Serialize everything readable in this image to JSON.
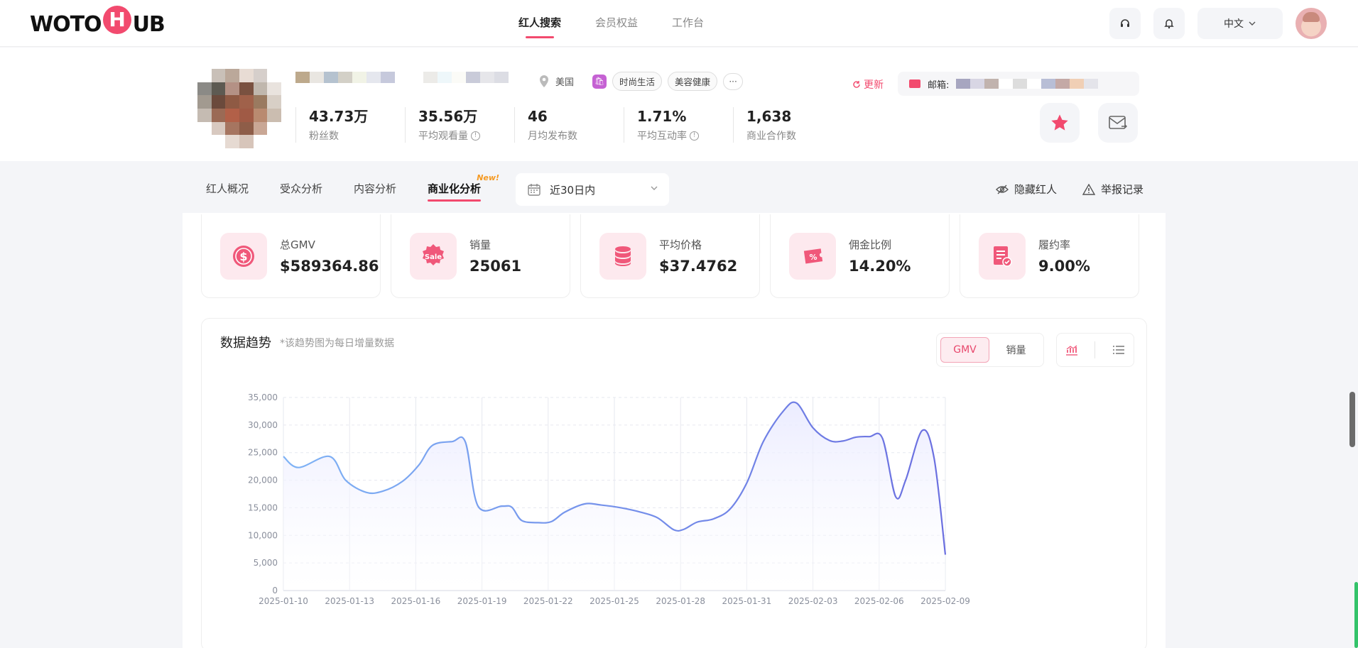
{
  "brand": {
    "logo_text_left": "WOTO",
    "logo_mark": "H",
    "logo_text_right": "UB",
    "accent": "#f24a6e"
  },
  "topnav": {
    "items": [
      {
        "label": "红人搜索",
        "active": true
      },
      {
        "label": "会员权益",
        "active": false
      },
      {
        "label": "工作台",
        "active": false
      }
    ],
    "language": "中文",
    "icons": [
      "headset-icon",
      "bell-icon",
      "chevron-down-icon",
      "user-avatar"
    ]
  },
  "profile": {
    "location": "美国",
    "tags": [
      "时尚生活",
      "美容健康"
    ],
    "more_label": "···",
    "stats": [
      {
        "value": "43.73万",
        "label": "粉丝数",
        "info": false
      },
      {
        "value": "35.56万",
        "label": "平均观看量",
        "info": true
      },
      {
        "value": "46",
        "label": "月均发布数",
        "info": false
      },
      {
        "value": "1.71%",
        "label": "平均互动率",
        "info": true
      },
      {
        "value": "1,638",
        "label": "商业合作数",
        "info": false
      }
    ],
    "update_label": "更新",
    "email_label": "邮箱:"
  },
  "tabs": {
    "items": [
      {
        "label": "红人概况",
        "active": false
      },
      {
        "label": "受众分析",
        "active": false
      },
      {
        "label": "内容分析",
        "active": false
      },
      {
        "label": "商业化分析",
        "active": true,
        "badge": "New!"
      }
    ],
    "date_range": "近30日内",
    "hide_label": "隐藏红人",
    "report_label": "举报记录"
  },
  "metrics": [
    {
      "label": "总GMV",
      "value": "$589364.86",
      "icon": "dollar-coin-icon"
    },
    {
      "label": "销量",
      "value": "25061",
      "icon": "sale-badge-icon"
    },
    {
      "label": "平均价格",
      "value": "$37.4762",
      "icon": "coin-stack-icon"
    },
    {
      "label": "佣金比例",
      "value": "14.20%",
      "icon": "ticket-percent-icon"
    },
    {
      "label": "履约率",
      "value": "9.00%",
      "icon": "document-check-icon"
    }
  ],
  "trend": {
    "title": "数据趋势",
    "note": "*该趋势图为每日增量数据",
    "toggle": [
      {
        "label": "GMV",
        "active": true
      },
      {
        "label": "销量",
        "active": false
      }
    ]
  },
  "chart_data": {
    "type": "area",
    "series": [
      {
        "values": [
          24300,
          22300,
          24300,
          20000,
          17800,
          18000,
          19800,
          22800,
          26300,
          27000,
          26900,
          15300,
          15300,
          15100,
          12700,
          12300,
          12500,
          14200,
          15700,
          15500,
          15000,
          14200,
          13200,
          11000,
          11100,
          12400,
          13000,
          14800,
          19500,
          27000,
          32500,
          34000,
          29500,
          27200,
          27100,
          27800,
          27900,
          27600,
          17000,
          20000,
          29000,
          24000,
          6500
        ],
        "x_fraction": [
          0,
          0.023,
          0.07,
          0.094,
          0.125,
          0.15,
          0.18,
          0.205,
          0.225,
          0.255,
          0.275,
          0.294,
          0.33,
          0.345,
          0.36,
          0.385,
          0.405,
          0.425,
          0.455,
          0.48,
          0.51,
          0.54,
          0.565,
          0.59,
          0.605,
          0.625,
          0.65,
          0.675,
          0.7,
          0.725,
          0.755,
          0.775,
          0.8,
          0.825,
          0.845,
          0.865,
          0.885,
          0.905,
          0.925,
          0.94,
          0.965,
          0.983,
          1.0
        ]
      }
    ],
    "x_tick_labels": [
      "2025-01-10",
      "2025-01-13",
      "2025-01-16",
      "2025-01-19",
      "2025-01-22",
      "2025-01-25",
      "2025-01-28",
      "2025-01-31",
      "2025-02-03",
      "2025-02-06",
      "2025-02-09"
    ],
    "y_ticks": [
      0,
      5000,
      10000,
      15000,
      20000,
      25000,
      30000,
      35000
    ],
    "y_tick_labels": [
      "0",
      "5,000",
      "10,000",
      "15,000",
      "20,000",
      "25,000",
      "30,000",
      "35,000"
    ],
    "ylim": [
      0,
      35000
    ],
    "grid": true,
    "colors": {
      "line_start": "#7fb3f5",
      "line_end": "#6b6fe0",
      "fill": "#e9eaff"
    }
  }
}
